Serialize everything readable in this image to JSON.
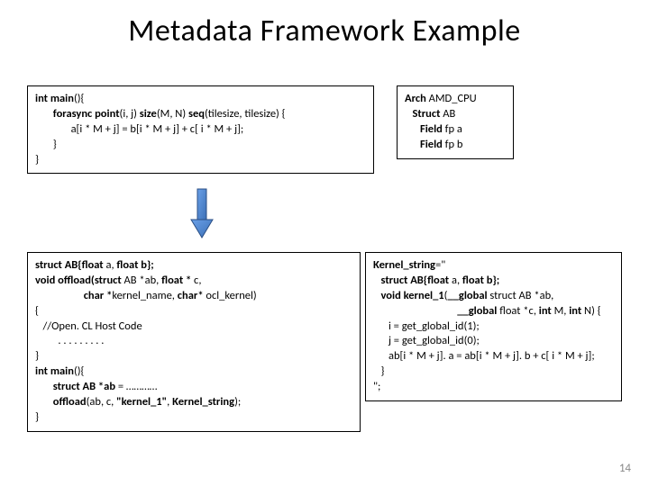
{
  "title": "Metadata Framework Example",
  "code_main": "int main(){\n       forasync point(i, j) size(M, N) seq(tilesize, tilesize) {\n              a[i * M + j] = b[i * M + j] + c[ i * M + j];\n       }\n}",
  "code_arch": "Arch AMD_CPU\n   Struct AB\n      Field fp a\n      Field fp b",
  "code_host": "struct AB{float a, float b};\nvoid offload(struct AB *ab, float * c,\n                   char *kernel_name, char* ocl_kernel)\n{\n   //Open. CL Host Code\n         . . . . . . . . .\n}\nint main(){\n       struct AB *ab = …………\n       offload(ab, c, \"kernel_1\", Kernel_string);\n}",
  "code_kernel": "Kernel_string=\"\n   struct AB{float a, float b};\n   void kernel_1(__global struct AB *ab,\n                                 __global float *c, int M, int N) {\n      i = get_global_id(1);\n      j = get_global_id(0);\n      ab[i * M + j]. a = ab[i * M + j]. b + c[ i * M + j];\n   }\n\";",
  "page_number": "14"
}
